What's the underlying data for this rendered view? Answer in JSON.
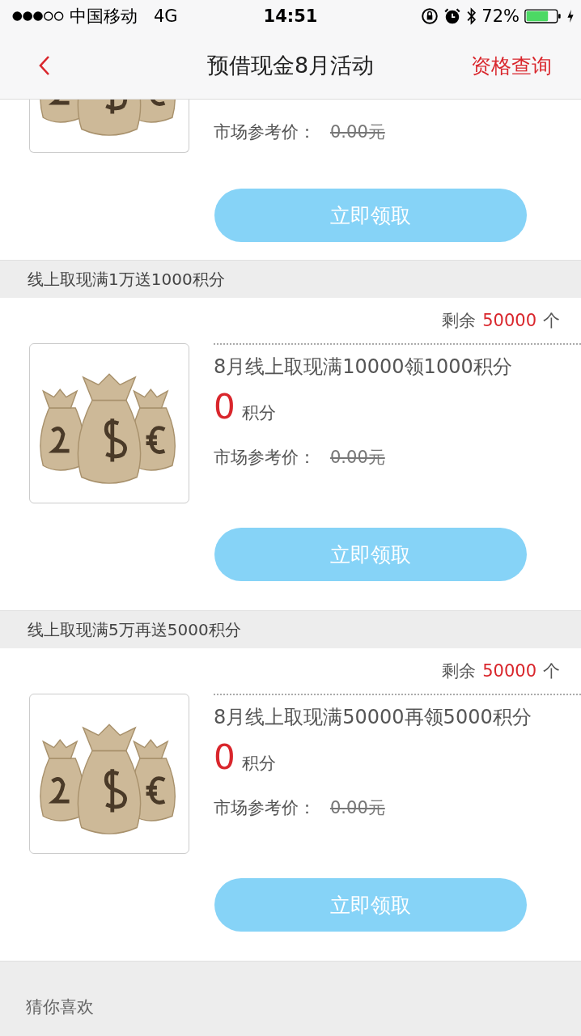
{
  "status_bar": {
    "carrier": "中国移动",
    "network": "4G",
    "time": "14:51",
    "battery": "72%"
  },
  "nav": {
    "title": "预借现金8月活动",
    "action": "资格查询"
  },
  "partial_item": {
    "market_label": "市场参考价：",
    "market_price": "0.00元",
    "button": "立即领取"
  },
  "sections": [
    {
      "header": "线上取现满1万送1000积分",
      "remaining_label": "剩余",
      "remaining": "50000",
      "unit": "个",
      "title": "8月线上取现满10000领1000积分",
      "points": "0",
      "points_unit": "积分",
      "market_label": "市场参考价：",
      "market_price": "0.00元",
      "button": "立即领取"
    },
    {
      "header": "线上取现满5万再送5000积分",
      "remaining_label": "剩余",
      "remaining": "50000",
      "unit": "个",
      "title": "8月线上取现满50000再领5000积分",
      "points": "0",
      "points_unit": "积分",
      "market_label": "市场参考价：",
      "market_price": "0.00元",
      "button": "立即领取"
    }
  ],
  "recommend": {
    "title": "猜你喜欢"
  }
}
